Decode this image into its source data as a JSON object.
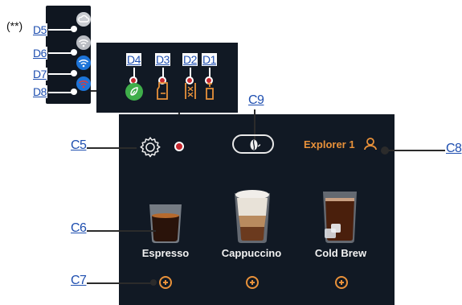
{
  "note": "(**)",
  "callouts": {
    "d1": "D1",
    "d2": "D2",
    "d3": "D3",
    "d4": "D4",
    "d5": "D5",
    "d6": "D6",
    "d7": "D7",
    "d8": "D8",
    "c5": "C5",
    "c6": "C6",
    "c7": "C7",
    "c8": "C8",
    "c9": "C9"
  },
  "screen": {
    "profile_name": "Explorer 1",
    "beverages": [
      {
        "label": "Espresso"
      },
      {
        "label": "Cappuccino"
      },
      {
        "label": "Cold Brew"
      }
    ]
  },
  "status_icons": [
    {
      "icon": "cloud-icon",
      "color": "#c9ccd1"
    },
    {
      "icon": "wifi-icon",
      "color": "#c9ccd1"
    },
    {
      "icon": "wifi-icon",
      "color": "#1d74d8"
    },
    {
      "icon": "wifi-off-icon",
      "color": "#1d74d8"
    }
  ],
  "colors": {
    "accent": "#e8913a",
    "screen_bg": "#111924",
    "callout": "#1f4fb0",
    "eco_green": "#3fae4a",
    "alert_red": "#c6262e"
  }
}
